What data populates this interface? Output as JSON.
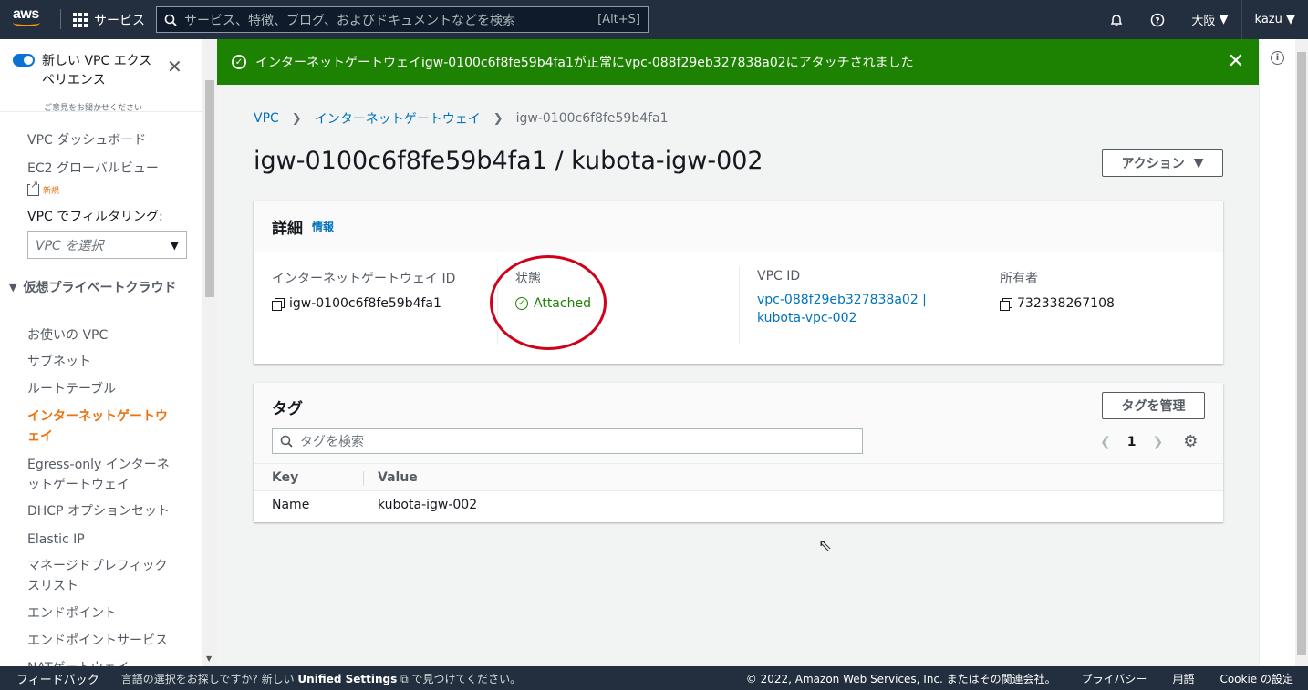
{
  "topnav": {
    "logo": "aws",
    "services": "サービス",
    "search_placeholder": "サービス、特徴、ブログ、およびドキュメントなどを検索",
    "search_shortcut": "[Alt+S]",
    "region": "大阪",
    "user": "kazu"
  },
  "sidebar": {
    "toggle_title": "新しい VPC エクスペリエンス",
    "toggle_sub": "ご意見をお聞かせください",
    "dashboard": "VPC ダッシュボード",
    "global_view": "EC2 グローバルビュー",
    "new_badge": "新規",
    "filter_label": "VPC でフィルタリング:",
    "filter_placeholder": "VPC を選択",
    "section": "仮想プライベートクラウド",
    "items": [
      "お使いの VPC",
      "サブネット",
      "ルートテーブル",
      "インターネットゲートウェイ",
      "Egress-only インターネットゲートウェイ",
      "DHCP オプションセット",
      "Elastic IP",
      "マネージドプレフィックスリスト",
      "エンドポイント",
      "エンドポイントサービス",
      "NATゲートウェイ"
    ]
  },
  "flash": {
    "message": "インターネットゲートウェイigw-0100c6f8fe59b4fa1が正常にvpc-088f29eb327838a02にアタッチされました"
  },
  "breadcrumb": {
    "root": "VPC",
    "parent": "インターネットゲートウェイ",
    "current": "igw-0100c6f8fe59b4fa1"
  },
  "page": {
    "title": "igw-0100c6f8fe59b4fa1 / kubota-igw-002",
    "action_button": "アクション"
  },
  "details": {
    "title": "詳細",
    "info": "情報",
    "igw_id_label": "インターネットゲートウェイ ID",
    "igw_id": "igw-0100c6f8fe59b4fa1",
    "state_label": "状態",
    "state": "Attached",
    "vpc_id_label": "VPC ID",
    "vpc_id": "vpc-088f29eb327838a02 | kubota-vpc-002",
    "owner_label": "所有者",
    "owner": "732338267108"
  },
  "tags": {
    "title": "タグ",
    "manage_button": "タグを管理",
    "search_placeholder": "タグを検索",
    "page": "1",
    "columns": [
      "Key",
      "Value"
    ],
    "rows": [
      {
        "key": "Name",
        "value": "kubota-igw-002"
      }
    ]
  },
  "footer": {
    "feedback": "フィードバック",
    "lang_prefix": "言語の選択をお探しですか? 新しい",
    "lang_link": "Unified Settings",
    "lang_suffix": "で見つけてください。",
    "copyright": "© 2022, Amazon Web Services, Inc. またはその関連会社。",
    "privacy": "プライバシー",
    "terms": "用語",
    "cookie": "Cookie の設定"
  },
  "colors": {
    "nav_bg": "#232f3e",
    "flash_bg": "#1d8102",
    "accent_orange": "#ec7211",
    "link_blue": "#0073bb",
    "annotation_red": "#d0021b"
  }
}
